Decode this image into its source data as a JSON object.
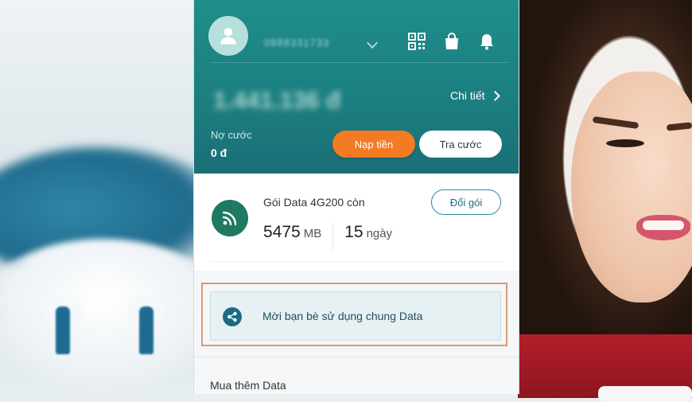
{
  "header": {
    "phone_number": "0888331733",
    "balance": "1.441.136 đ",
    "detail_label": "Chi tiết",
    "debt_label": "Nợ cước",
    "debt_value": "0 đ",
    "topup_button": "Nạp tiền",
    "check_button": "Tra cước"
  },
  "data_package": {
    "label": "Gói Data 4G200 còn",
    "data_amount": "5475",
    "data_unit": "MB",
    "days_amount": "15",
    "days_unit": "ngày",
    "change_button": "Đổi gói"
  },
  "share": {
    "label": "Mời bạn bè sử dụng chung Data"
  },
  "more_data": {
    "label": "Mua thêm Data"
  },
  "colors": {
    "header_teal": "#1c7f80",
    "topup_orange": "#f47a23",
    "data_green": "#1e7a62",
    "highlight_outline": "#d39b7c"
  },
  "icons": [
    "user-icon",
    "chevron-down-icon",
    "qr-code-icon",
    "shopping-bag-icon",
    "bell-icon",
    "chevron-right-icon",
    "wifi-signal-icon",
    "share-icon"
  ]
}
